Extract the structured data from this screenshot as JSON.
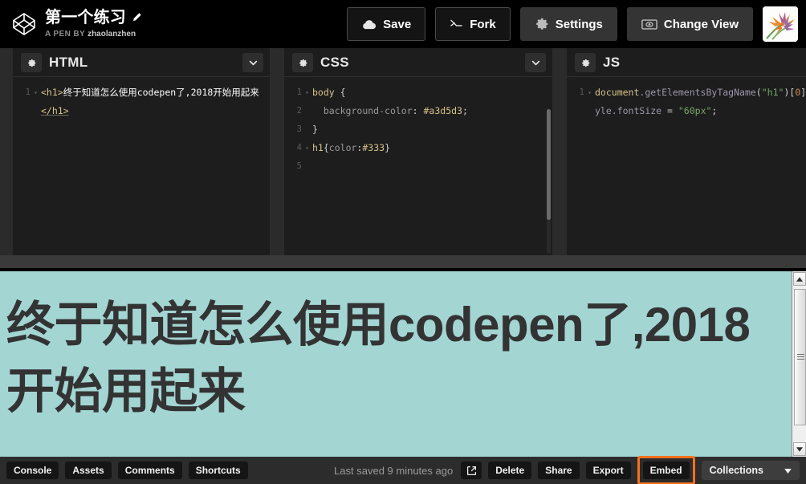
{
  "header": {
    "logo_icon": "codepen-logo-icon",
    "pen_title": "第一个练习",
    "edit_icon": "pencil-icon",
    "byline_prefix": "A PEN BY",
    "author": "zhaolanzhen",
    "buttons": [
      {
        "label": "Save",
        "icon": "cloud-icon",
        "style": "outline"
      },
      {
        "label": "Fork",
        "icon": "fork-icon",
        "style": "outline"
      },
      {
        "label": "Settings",
        "icon": "gear-icon",
        "style": "solid"
      },
      {
        "label": "Change View",
        "icon": "screen-icon",
        "style": "solid"
      }
    ],
    "avatar_alt": "user-avatar"
  },
  "editors": [
    {
      "label": "HTML",
      "settings_icon": "gear-icon",
      "collapse_icon": "chevron-down-icon",
      "lines": [
        {
          "num": "1",
          "fold": "▾",
          "parts": [
            {
              "t": "<h1>",
              "c": "tag"
            },
            {
              "t": "终于知道怎么使用codepen了,2018开始用起来",
              "c": "plain"
            },
            {
              "t": "</h1>",
              "c": "tag under"
            }
          ]
        }
      ]
    },
    {
      "label": "CSS",
      "settings_icon": "gear-icon",
      "collapse_icon": "chevron-down-icon",
      "lines": [
        {
          "num": "1",
          "fold": "▾",
          "parts": [
            {
              "t": "body ",
              "c": "sel"
            },
            {
              "t": "{",
              "c": "punc"
            }
          ]
        },
        {
          "num": "2",
          "fold": "",
          "parts": [
            {
              "t": "  background-color",
              "c": "prop"
            },
            {
              "t": ": ",
              "c": "punc"
            },
            {
              "t": "#a3d5d3",
              "c": "val"
            },
            {
              "t": ";",
              "c": "punc"
            }
          ]
        },
        {
          "num": "3",
          "fold": "",
          "parts": [
            {
              "t": "}",
              "c": "punc"
            }
          ]
        },
        {
          "num": "4",
          "fold": "▾",
          "parts": [
            {
              "t": "h1",
              "c": "sel"
            },
            {
              "t": "{",
              "c": "punc"
            },
            {
              "t": "color",
              "c": "prop"
            },
            {
              "t": ":",
              "c": "punc"
            },
            {
              "t": "#333",
              "c": "val"
            },
            {
              "t": "}",
              "c": "punc"
            }
          ]
        },
        {
          "num": "5",
          "fold": "",
          "parts": [
            {
              "t": "",
              "c": "plain"
            }
          ]
        }
      ]
    },
    {
      "label": "JS",
      "settings_icon": "gear-icon",
      "collapse_icon": "chevron-down-icon",
      "lines": [
        {
          "num": "1",
          "fold": "▾",
          "parts": [
            {
              "t": "document",
              "c": "obj"
            },
            {
              "t": ".getElementsByTagName",
              "c": "meth"
            },
            {
              "t": "(",
              "c": "punc"
            },
            {
              "t": "\"h1\"",
              "c": "str"
            },
            {
              "t": ")",
              "c": "punc"
            },
            {
              "t": "[",
              "c": "punc"
            },
            {
              "t": "0",
              "c": "num"
            },
            {
              "t": "]",
              "c": "punc"
            },
            {
              "t": ".style",
              "c": "meth"
            },
            {
              "t": ".fontSize",
              "c": "meth"
            },
            {
              "t": " = ",
              "c": "op"
            },
            {
              "t": "\"60px\"",
              "c": "str"
            },
            {
              "t": ";",
              "c": "punc"
            }
          ]
        }
      ]
    }
  ],
  "preview": {
    "heading": "终于知道怎么使用codepen了,2018开始用起来",
    "background_color": "#a3d5d3",
    "text_color": "#333333",
    "font_size": "60px",
    "scrollbar": {
      "up_icon": "triangle-up-icon",
      "down_icon": "triangle-down-icon"
    }
  },
  "footer": {
    "left_buttons": [
      {
        "label": "Console"
      },
      {
        "label": "Assets"
      },
      {
        "label": "Comments"
      },
      {
        "label": "Shortcuts"
      }
    ],
    "saved_status": "Last saved 9 minutes ago",
    "external_icon": "external-link-icon",
    "right_buttons": [
      {
        "label": "Delete"
      },
      {
        "label": "Share"
      },
      {
        "label": "Export"
      }
    ],
    "embed_button": {
      "label": "Embed",
      "highlighted": true,
      "highlight_color": "#f4711f"
    },
    "collections": {
      "label": "Collections",
      "caret_icon": "caret-down-icon"
    }
  }
}
